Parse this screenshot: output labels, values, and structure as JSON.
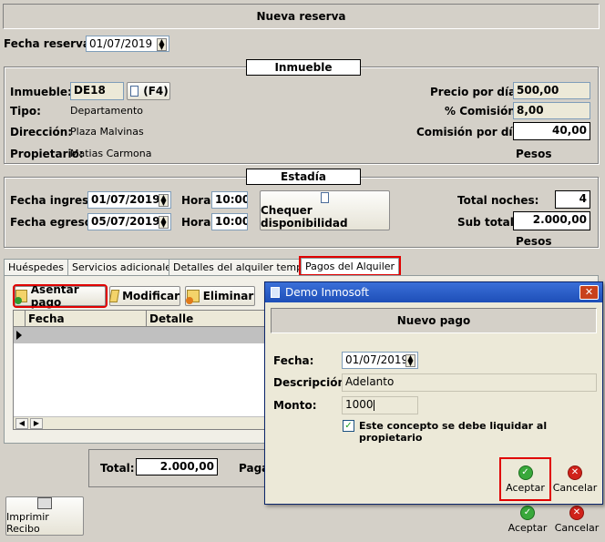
{
  "header": {
    "title": "Nueva reserva"
  },
  "reserva": {
    "fecha_label": "Fecha reserva:",
    "fecha_value": "01/07/2019"
  },
  "inmueble": {
    "section_title": "Inmueble",
    "inmueble_label": "Inmueble:",
    "inmueble_value": "DE18",
    "f4_label": "(F4)",
    "tipo_label": "Tipo:",
    "tipo_value": "Departamento",
    "direccion_label": "Dirección:",
    "direccion_value": "Plaza Malvinas",
    "propietario_label": "Propietario:",
    "propietario_value": "Matias Carmona",
    "precio_label": "Precio por día:",
    "precio_value": "500,00",
    "comision_pct_label": "% Comisión:",
    "comision_pct_value": "8,00",
    "comision_dia_label": "Comisión por día:",
    "comision_dia_value": "40,00",
    "moneda": "Pesos"
  },
  "estadia": {
    "section_title": "Estadía",
    "ingreso_label": "Fecha ingreso:",
    "ingreso_value": "01/07/2019",
    "egreso_label": "Fecha egreso:",
    "egreso_value": "05/07/2019",
    "hora_label": "Hora:",
    "hora_ingreso": "10:00",
    "hora_egreso": "10:00",
    "chequear_label": "Chequer disponibilidad",
    "noches_label": "Total noches:",
    "noches_value": "4",
    "subtotal_label": "Sub total:",
    "subtotal_value": "2.000,00",
    "moneda": "Pesos"
  },
  "tabs": [
    {
      "label": "Huéspedes"
    },
    {
      "label": "Servicios adicionales"
    },
    {
      "label": "Detalles del alquiler temporal"
    },
    {
      "label": "Pagos del Alquiler"
    }
  ],
  "pagos": {
    "asentar_label": "Asentar pago",
    "modificar_label": "Modificar",
    "eliminar_label": "Eliminar",
    "columns": [
      "Fecha",
      "Detalle"
    ]
  },
  "totales": {
    "total_label": "Total:",
    "total_value": "2.000,00",
    "pagado_label": "Paga"
  },
  "footer": {
    "imprimir_label": "Imprimir Recibo",
    "aceptar_label": "Aceptar",
    "cancelar_label": "Cancelar"
  },
  "dialog": {
    "window_title": "Demo Inmosoft",
    "close_glyph": "✕",
    "header_title": "Nuevo pago",
    "fecha_label": "Fecha:",
    "fecha_value": "01/07/2019",
    "descripcion_label": "Descripción:",
    "descripcion_value": "Adelanto",
    "monto_label": "Monto:",
    "monto_value": "1000",
    "checkbox_label": "Este concepto se debe liquidar al propietario",
    "checkbox_checked": true,
    "aceptar_label": "Aceptar",
    "cancelar_label": "Cancelar"
  }
}
